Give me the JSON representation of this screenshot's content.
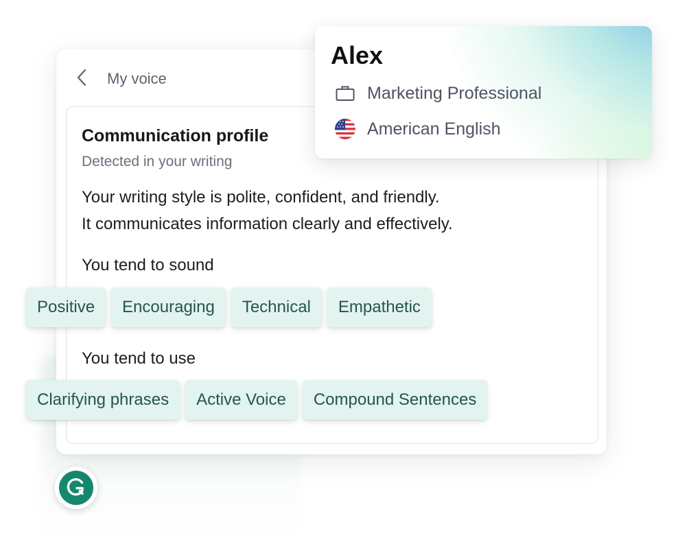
{
  "header": {
    "back_label": "Back",
    "title": "My voice"
  },
  "profile": {
    "name": "Alex",
    "role": "Marketing Professional",
    "role_icon": "briefcase-icon",
    "language": "American English",
    "language_icon": "us-flag-icon"
  },
  "card": {
    "title": "Communication profile",
    "subtitle": "Detected in your writing",
    "summary_lines": [
      "Your writing style is polite, confident, and friendly.",
      "It communicates information clearly and effectively."
    ],
    "sound_label": "You tend to sound",
    "sound_tags": [
      "Positive",
      "Encouraging",
      "Technical",
      "Empathetic"
    ],
    "use_label": "You tend to use",
    "use_tags": [
      "Clarifying phrases",
      "Active Voice",
      "Compound Sentences"
    ]
  },
  "logo": {
    "icon": "grammarly-logo-icon"
  },
  "colors": {
    "chip_background": "#e3f3ef",
    "chip_text": "#24564a",
    "brand_green": "#15876c",
    "muted_text": "#5d6170"
  }
}
